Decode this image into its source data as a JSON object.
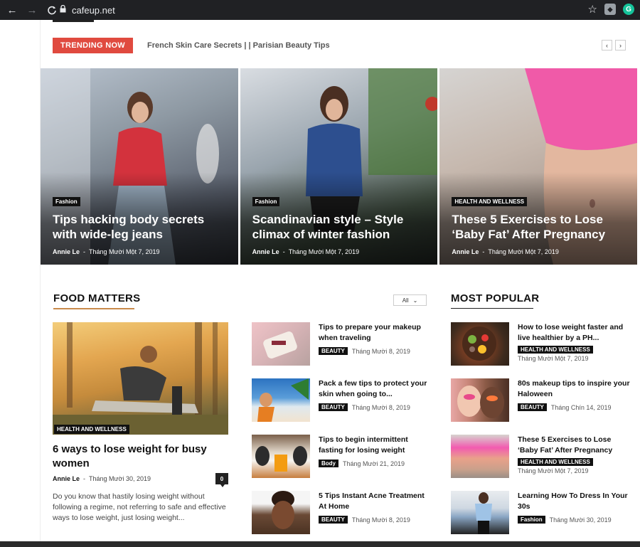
{
  "browser": {
    "url": "cafeup.net",
    "back_icon": "←",
    "forward_icon": "→",
    "reload_icon": "C",
    "star_icon": "☆",
    "ext_badge": "G"
  },
  "trending": {
    "label": "TRENDING NOW",
    "headline": "French Skin Care Secrets | | Parisian Beauty Tips",
    "prev": "‹",
    "next": "›"
  },
  "hero": [
    {
      "category": "Fashion",
      "title": "Tips hacking body secrets with wide-leg jeans",
      "author": "Annie Le",
      "date": "Tháng Mười Một 7, 2019"
    },
    {
      "category": "Fashion",
      "title": "Scandinavian style – Style climax of winter fashion",
      "author": "Annie Le",
      "date": "Tháng Mười Một 7, 2019"
    },
    {
      "category": "HEALTH AND WELLNESS",
      "title": "These 5 Exercises to Lose ‘Baby Fat’ After Pregnancy",
      "author": "Annie Le",
      "date": "Tháng Mười Một 7, 2019"
    }
  ],
  "food": {
    "heading": "FOOD MATTERS",
    "filter_label": "All",
    "featured": {
      "category": "HEALTH AND WELLNESS",
      "title": "6 ways to lose weight for busy women",
      "author": "Annie Le",
      "date": "Tháng Mười 30, 2019",
      "comments": "0",
      "excerpt": "Do you know that hastily losing weight without following a regime, not referring to safe and effective ways to lose weight, just losing weight..."
    },
    "items": [
      {
        "title": "Tips to prepare your makeup when traveling",
        "category": "BEAUTY",
        "date": "Tháng Mười 8, 2019"
      },
      {
        "title": "Pack a few tips to protect your skin when going to...",
        "category": "BEAUTY",
        "date": "Tháng Mười 8, 2019"
      },
      {
        "title": "Tips to begin intermittent fasting for losing weight",
        "category": "Body",
        "date": "Tháng Mười 21, 2019"
      },
      {
        "title": "5 Tips Instant Acne Treatment At Home",
        "category": "BEAUTY",
        "date": "Tháng Mười 8, 2019"
      }
    ]
  },
  "popular": {
    "heading": "MOST POPULAR",
    "items": [
      {
        "title": "How to lose weight faster and live healthier by a PH...",
        "category": "HEALTH AND WELLNESS",
        "date": "Tháng Mười Một 7, 2019"
      },
      {
        "title": "80s makeup tips to inspire your Haloween",
        "category": "BEAUTY",
        "date": "Tháng Chín 14, 2019"
      },
      {
        "title": "These 5 Exercises to Lose ‘Baby Fat’ After Pregnancy",
        "category": "HEALTH AND WELLNESS",
        "date": "Tháng Mười Một 7, 2019"
      },
      {
        "title": "Learning How To Dress In Your 30s",
        "category": "Fashion",
        "date": "Tháng Mười 30, 2019"
      }
    ]
  }
}
